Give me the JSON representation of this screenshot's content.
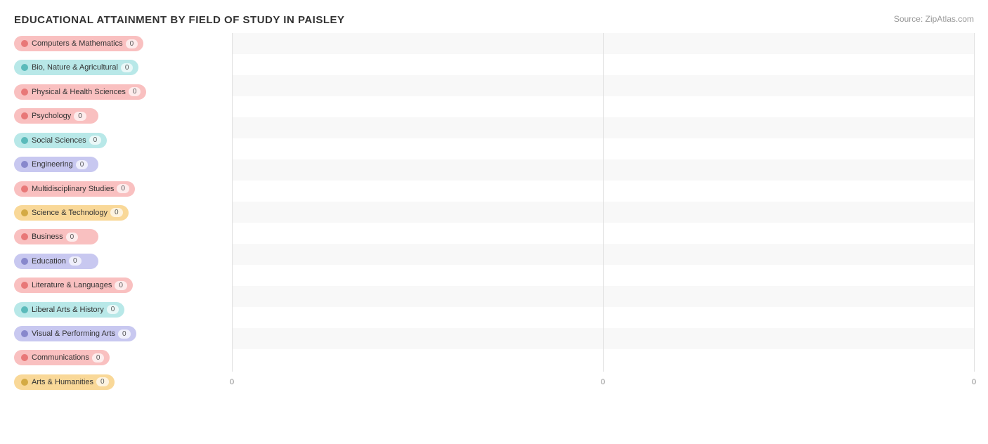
{
  "title": "EDUCATIONAL ATTAINMENT BY FIELD OF STUDY IN PAISLEY",
  "source": "Source: ZipAtlas.com",
  "bars": [
    {
      "label": "Computers & Mathematics",
      "value": 0,
      "colorClass": "c1",
      "bg": "#fde8e8"
    },
    {
      "label": "Bio, Nature & Agricultural",
      "value": 0,
      "colorClass": "c2",
      "bg": "#e0f4f4"
    },
    {
      "label": "Physical & Health Sciences",
      "value": 0,
      "colorClass": "c3",
      "bg": "#fde8e8"
    },
    {
      "label": "Psychology",
      "value": 0,
      "colorClass": "c4",
      "bg": "#fde8e8"
    },
    {
      "label": "Social Sciences",
      "value": 0,
      "colorClass": "c5",
      "bg": "#e0f4f4"
    },
    {
      "label": "Engineering",
      "value": 0,
      "colorClass": "c6",
      "bg": "#e8e8f8"
    },
    {
      "label": "Multidisciplinary Studies",
      "value": 0,
      "colorClass": "c7",
      "bg": "#fde8e8"
    },
    {
      "label": "Science & Technology",
      "value": 0,
      "colorClass": "c8",
      "bg": "#fdefd8"
    },
    {
      "label": "Business",
      "value": 0,
      "colorClass": "c9",
      "bg": "#fde8e8"
    },
    {
      "label": "Education",
      "value": 0,
      "colorClass": "c10",
      "bg": "#e8e8f8"
    },
    {
      "label": "Literature & Languages",
      "value": 0,
      "colorClass": "c11",
      "bg": "#fde8e8"
    },
    {
      "label": "Liberal Arts & History",
      "value": 0,
      "colorClass": "c12",
      "bg": "#e0f4f4"
    },
    {
      "label": "Visual & Performing Arts",
      "value": 0,
      "colorClass": "c13",
      "bg": "#e8e8f8"
    },
    {
      "label": "Communications",
      "value": 0,
      "colorClass": "c14",
      "bg": "#fde8e8"
    },
    {
      "label": "Arts & Humanities",
      "value": 0,
      "colorClass": "c15",
      "bg": "#fdefd8"
    }
  ],
  "xAxisLabels": [
    "0",
    "0",
    "0"
  ],
  "xAxisPositions": [
    0,
    50,
    100
  ]
}
